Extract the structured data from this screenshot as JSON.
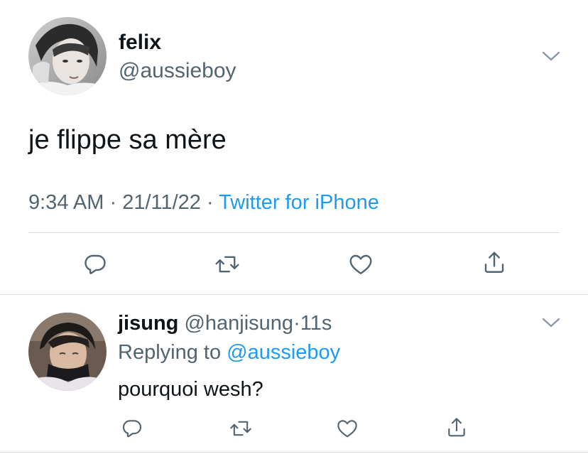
{
  "main_tweet": {
    "author_name": "felix",
    "author_handle": "@aussieboy",
    "text": "je flippe sa mère",
    "time": "9:34 AM",
    "separator": " · ",
    "date": "21/11/22",
    "source": "Twitter for iPhone",
    "actions": [
      "reply-icon",
      "retweet-icon",
      "like-icon",
      "share-icon"
    ]
  },
  "reply_tweet": {
    "author_name": "jisung",
    "author_handle": "@hanjisung",
    "dot": "·",
    "age": "11s",
    "replying_prefix": "Replying to ",
    "replying_to": "@aussieboy",
    "text": "pourquoi wesh?",
    "actions": [
      "reply-icon",
      "retweet-icon",
      "like-icon",
      "share-icon"
    ]
  },
  "colors": {
    "text_primary": "#0f1419",
    "text_secondary": "#536471",
    "accent": "#1d9bf0",
    "divider": "#d6dbe0"
  }
}
